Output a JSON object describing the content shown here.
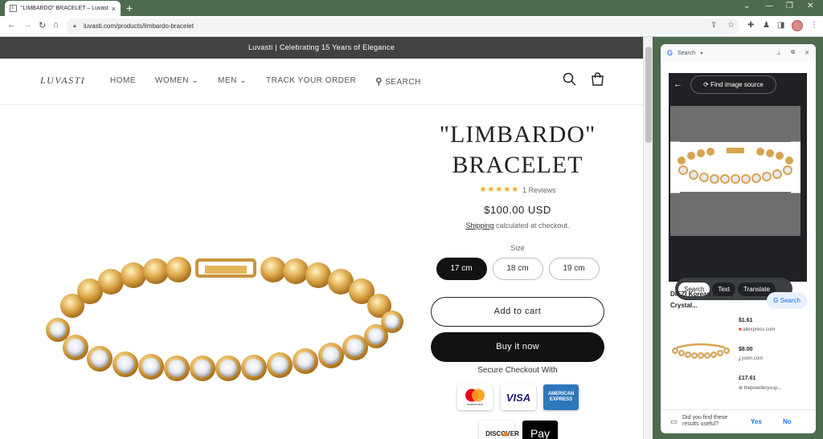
{
  "browser": {
    "tab_title": "\"LIMBARDO\" BRACELET – Luvasti",
    "url": "luvasti.com/products/limbardo-bracelet",
    "new_tab_symbol": "+",
    "tab_close": "×"
  },
  "site": {
    "announcement": "Luvasti | Celebrating 15 Years of Elegance",
    "logo": "LUVASTI",
    "nav": [
      "HOME",
      "WOMEN ⌄",
      "MEN ⌄",
      "TRACK YOUR ORDER",
      "SEARCH"
    ]
  },
  "product": {
    "title_line1": "\"LIMBARDO\"",
    "title_line2": "BRACELET",
    "stars": "★★★★★",
    "reviews": "1 Reviews",
    "price": "$100.00 USD",
    "shipping_link": "Shipping",
    "shipping_rest": " calculated at checkout.",
    "size_label": "Size",
    "sizes": [
      "17 cm",
      "18 cm",
      "19 cm"
    ],
    "selected_size": "17 cm",
    "add_to_cart": "Add to cart",
    "buy_now": "Buy it now",
    "secure_checkout": "Secure Checkout With",
    "payment_methods": [
      "mastercard",
      "VISA",
      "AMERICAN EXPRESS",
      "DISCOVER",
      "Pay"
    ]
  },
  "side_panel": {
    "provider": "Search",
    "find_source": "Find image source",
    "modes": [
      "Search",
      "Text",
      "Translate"
    ],
    "selected_mode": "Search",
    "result_title": "DIEZI Korean Luxury Crystal...",
    "result_search": "Search",
    "offers": [
      {
        "price": "$1.61",
        "store": "aliexpress.com"
      },
      {
        "price": "$8.00",
        "store": "joom.com"
      },
      {
        "price": "£17.61",
        "store": "thejewellerysup..."
      }
    ],
    "feedback_q": "Did you find these results useful?",
    "yes": "Yes",
    "no": "No"
  },
  "colors": {
    "frame": "#4d6b4f",
    "announce_bg": "#424242",
    "star": "#f0a51a",
    "gold": "#d7a24a",
    "link_blue": "#1a73e8"
  }
}
